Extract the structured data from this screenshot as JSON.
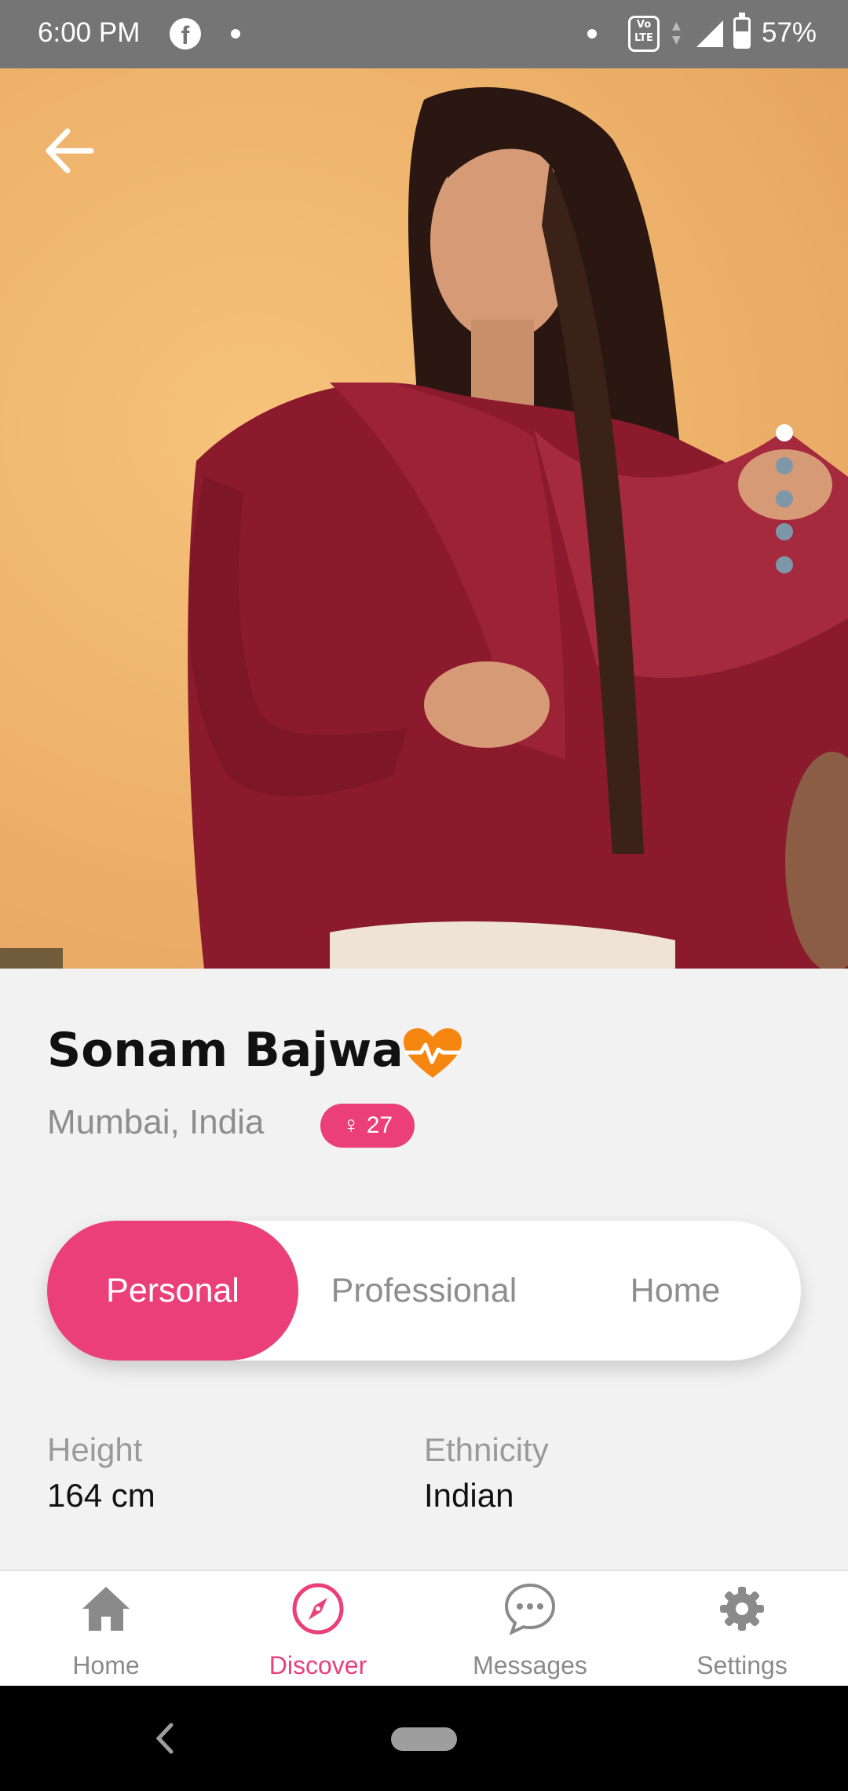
{
  "status_bar": {
    "time": "6:00 PM",
    "battery": "57%",
    "battery_level": 0.57,
    "app_icon": "facebook-icon",
    "volte": "Vo LTE"
  },
  "photo": {
    "back_icon": "arrow-left-icon",
    "page_count": 5,
    "current_page": 1
  },
  "profile": {
    "name": "Sonam Bajwa",
    "location": "Mumbai, India",
    "gender_symbol": "♀",
    "age": "27",
    "status_icon": "heart-pulse-icon"
  },
  "tabs": [
    {
      "label": "Personal",
      "active": true
    },
    {
      "label": "Professional",
      "active": false
    },
    {
      "label": "Home",
      "active": false
    }
  ],
  "attributes": [
    {
      "label": "Height",
      "value": "164 cm"
    },
    {
      "label": "Ethnicity",
      "value": "Indian"
    }
  ],
  "bottom_nav": [
    {
      "label": "Home",
      "icon": "home-icon",
      "active": false
    },
    {
      "label": "Discover",
      "icon": "compass-icon",
      "active": true
    },
    {
      "label": "Messages",
      "icon": "chat-icon",
      "active": false
    },
    {
      "label": "Settings",
      "icon": "gear-icon",
      "active": false
    }
  ],
  "colors": {
    "accent": "#eb3f7a",
    "status_icon": "#f5860f",
    "status_bar": "#757575"
  }
}
